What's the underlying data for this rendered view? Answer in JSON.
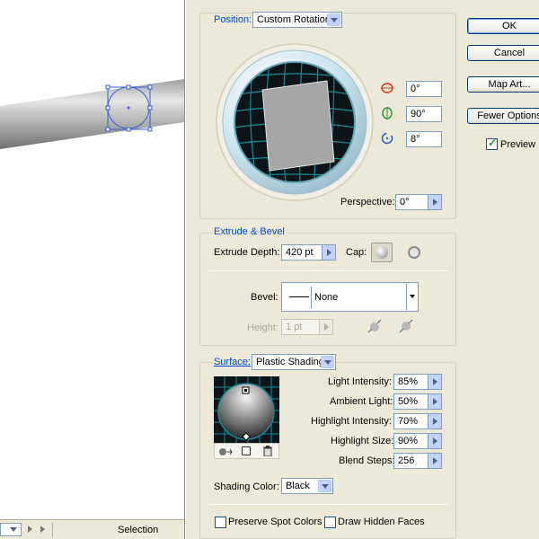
{
  "statusbar": {
    "mode": "Selection"
  },
  "dialog": {
    "position": {
      "title": "Position:",
      "preset": "Custom Rotation",
      "x_rotation": "0°",
      "y_rotation": "90°",
      "z_rotation": "8°",
      "perspective_label": "Perspective:",
      "perspective": "0°"
    },
    "extrude": {
      "title": "Extrude & Bevel",
      "depth_label": "Extrude Depth:",
      "depth": "420 pt",
      "cap_label": "Cap:",
      "bevel_label": "Bevel:",
      "bevel": "None",
      "height_label": "Height:",
      "height": "1 pt"
    },
    "surface": {
      "title": "Surface:",
      "type": "Plastic Shading",
      "light_intensity_label": "Light Intensity:",
      "light_intensity": "85%",
      "ambient_light_label": "Ambient Light:",
      "ambient_light": "50%",
      "highlight_intensity_label": "Highlight Intensity:",
      "highlight_intensity": "70%",
      "highlight_size_label": "Highlight Size:",
      "highlight_size": "90%",
      "blend_steps_label": "Blend Steps:",
      "blend_steps": "256",
      "shading_color_label": "Shading Color:",
      "shading_color": "Black",
      "preserve_spot_label": "Preserve Spot Colors",
      "draw_hidden_label": "Draw Hidden Faces"
    },
    "buttons": {
      "ok": "OK",
      "cancel": "Cancel",
      "map_art": "Map Art...",
      "fewer_options": "Fewer Options",
      "preview": "Preview"
    }
  },
  "colors": {
    "accent": "#0046d5",
    "cube_grid": "#1a7f8a",
    "face": "#a6a6a6"
  }
}
